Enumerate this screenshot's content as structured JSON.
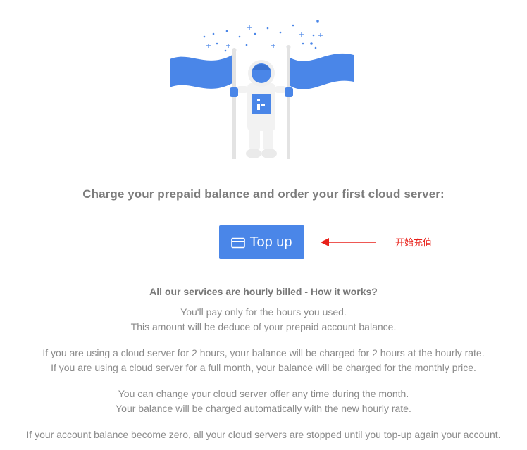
{
  "headline": "Charge your prepaid balance and order your first cloud server:",
  "topup_button": {
    "label": "Top up",
    "icon": "credit-card-icon"
  },
  "annotation": {
    "text": "开始充值",
    "color": "#e8211a"
  },
  "how_it_works": {
    "title": "All our services are hourly billed - How it works?",
    "paragraphs": [
      [
        "You'll pay only for the hours you used.",
        "This amount will be deduce of your prepaid account balance."
      ],
      [
        "If you are using a cloud server for 2 hours, your balance will be charged for 2 hours at the hourly rate.",
        "If you are using a cloud server for a full month, your balance will be charged for the monthly price."
      ],
      [
        "You can change your cloud server offer any time during the month.",
        "Your balance will be charged automatically with the new hourly rate."
      ],
      [
        "If your account balance become zero, all your cloud servers are stopped until you top-up again your account."
      ]
    ]
  },
  "colors": {
    "accent": "#4a86e8",
    "text": "#7a7a7a",
    "annotation": "#e8211a"
  }
}
